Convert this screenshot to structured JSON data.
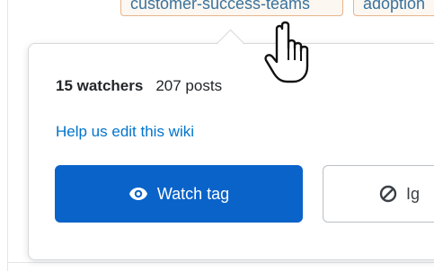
{
  "tags": [
    "customer-success-teams",
    "adoption"
  ],
  "popover": {
    "watchers": "15 watchers",
    "posts": "207 posts",
    "edit_link": "Help us edit this wiki",
    "watch_button": "Watch tag",
    "ignore_button": "Ig"
  },
  "colors": {
    "primary": "#0a63c9",
    "link": "#0074cc",
    "tag_border": "#e7b48a"
  },
  "icons": {
    "watch": "eye-icon",
    "ignore": "ban-icon",
    "cursor": "hand-pointer-cursor"
  }
}
